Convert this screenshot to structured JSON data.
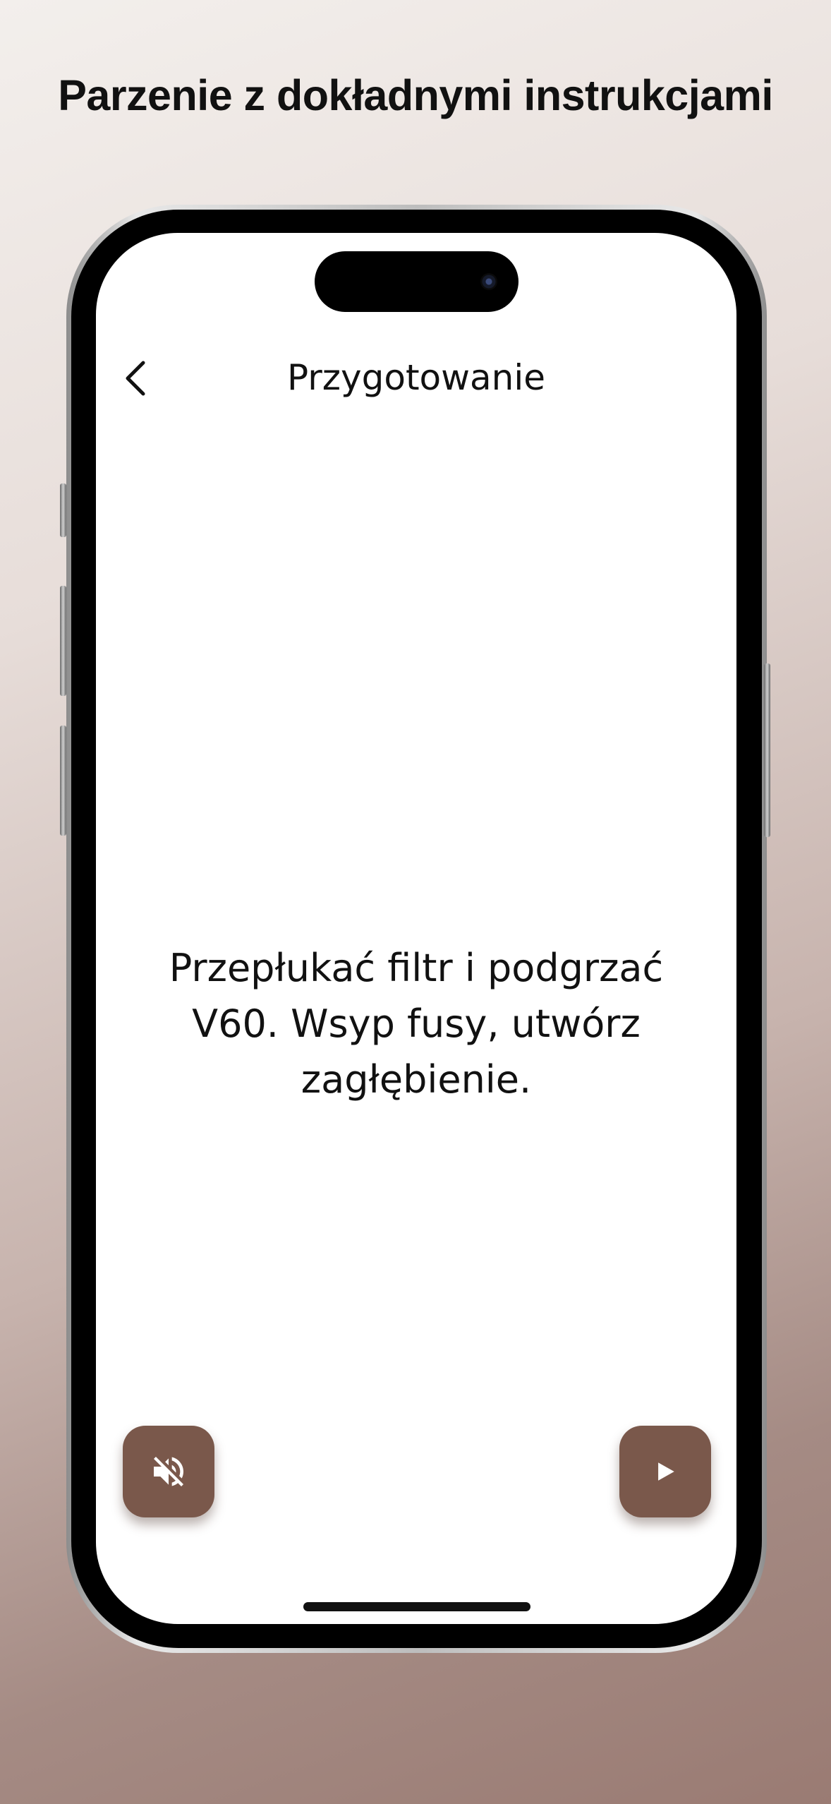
{
  "headline": "Parzenie z dokładnymi instrukcjami",
  "nav": {
    "title": "Przygotowanie",
    "back_icon": "chevron-left-icon"
  },
  "instruction": {
    "text": "Przepłukać filtr i podgrzać V60. Wsyp fusy, utwórz zagłębienie."
  },
  "controls": {
    "mute_icon": "volume-off-icon",
    "play_icon": "play-icon"
  },
  "colors": {
    "button_bg": "#7a584b",
    "button_icon": "#ffffff",
    "text": "#111111"
  }
}
